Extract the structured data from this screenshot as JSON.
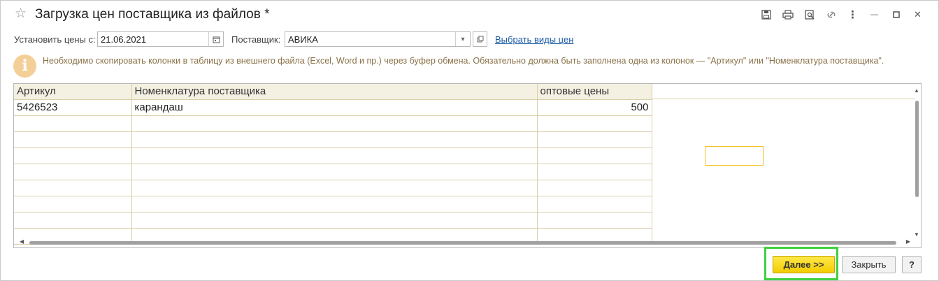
{
  "window": {
    "title": "Загрузка цен поставщика из файлов *",
    "toolbar_icons": [
      "save-icon",
      "print-icon",
      "preview-icon",
      "link-icon",
      "more-icon",
      "minimize-icon",
      "maximize-icon",
      "close-icon"
    ],
    "more_glyph": "⋮",
    "minimize_glyph": "—",
    "close_glyph": "✕"
  },
  "params": {
    "date_label": "Установить цены с:",
    "date_value": "21.06.2021",
    "supplier_label": "Поставщик:",
    "supplier_value": "АВИКА",
    "price_types_link": "Выбрать виды цен"
  },
  "info": {
    "icon_glyph": "i",
    "text": "Необходимо скопировать колонки в таблицу из внешнего файла (Excel, Word и пр.) через буфер обмена. Обязательно должна быть заполнена одна из колонок — \"Артикул\" или \"Номенклатура поставщика\"."
  },
  "table": {
    "columns": [
      "Артикул",
      "Номенклатура поставщика",
      "оптовые цены"
    ],
    "rows": [
      [
        "5426523",
        "карандаш",
        "500"
      ],
      [
        "",
        "",
        ""
      ],
      [
        "",
        "",
        ""
      ],
      [
        "",
        "",
        ""
      ],
      [
        "",
        "",
        ""
      ],
      [
        "",
        "",
        ""
      ],
      [
        "",
        "",
        ""
      ],
      [
        "",
        "",
        ""
      ],
      [
        "",
        "",
        ""
      ]
    ]
  },
  "buttons": {
    "next": "Далее >>",
    "close": "Закрыть",
    "help": "?"
  },
  "colors": {
    "accent_yellow": "#f3cb00",
    "highlight_green": "#3fd13f",
    "header_bg": "#f4f0e2",
    "link": "#1c5aa6"
  }
}
